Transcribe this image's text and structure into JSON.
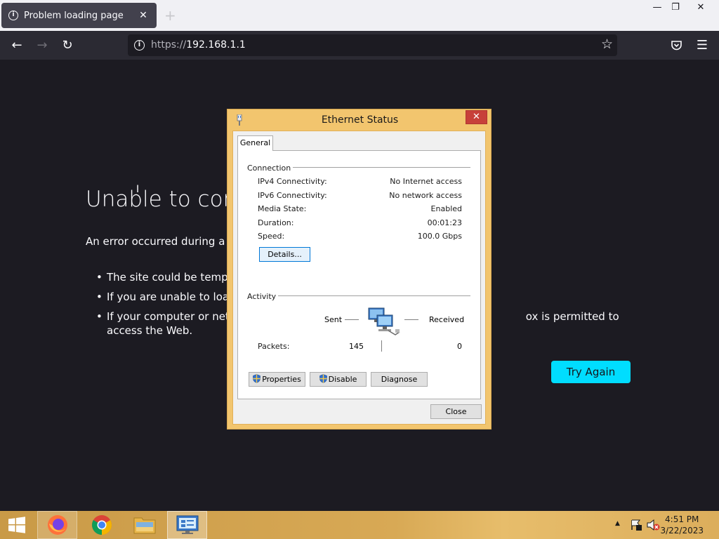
{
  "browser": {
    "tab": {
      "title": "Problem loading page",
      "close": "✕"
    },
    "new_tab": "+",
    "window": {
      "minimize": "—",
      "restore": "❐",
      "close": "✕"
    },
    "nav": {
      "back": "←",
      "forward": "→",
      "reload": "↻",
      "menu": "☰"
    },
    "url": {
      "scheme": "https://",
      "host": "192.168.1.1"
    },
    "bookmark_star": "☆"
  },
  "error_page": {
    "title": "Unable to conn",
    "description": "An error occurred during a con",
    "bullets": [
      "The site could be tempora",
      "If you are unable to load a",
      "If your computer or netwo                                                                                    ox is permitted to access the Web."
    ],
    "try_again": "Try Again"
  },
  "ethernet_dialog": {
    "title": "Ethernet Status",
    "close_x": "✕",
    "tab": "General",
    "connection": {
      "label": "Connection",
      "rows": [
        {
          "label": "IPv4 Connectivity:",
          "value": "No Internet access"
        },
        {
          "label": "IPv6 Connectivity:",
          "value": "No network access"
        },
        {
          "label": "Media State:",
          "value": "Enabled"
        },
        {
          "label": "Duration:",
          "value": "00:01:23"
        },
        {
          "label": "Speed:",
          "value": "100.0 Gbps"
        }
      ],
      "details_button": "Details..."
    },
    "activity": {
      "label": "Activity",
      "sent": "Sent",
      "received": "Received",
      "packets_label": "Packets:",
      "packets_sent": "145",
      "packets_received": "0"
    },
    "buttons": {
      "properties": "Properties",
      "disable": "Disable",
      "diagnose": "Diagnose"
    },
    "close_button": "Close"
  },
  "taskbar": {
    "clock_time": "4:51 PM",
    "clock_date": "3/22/2023",
    "tray_arrow": "▲"
  },
  "colors": {
    "page_bg": "#1c1b22",
    "accent_button": "#00ddff",
    "dialog_frame": "#f2c56e",
    "dialog_close": "#c7403a"
  }
}
